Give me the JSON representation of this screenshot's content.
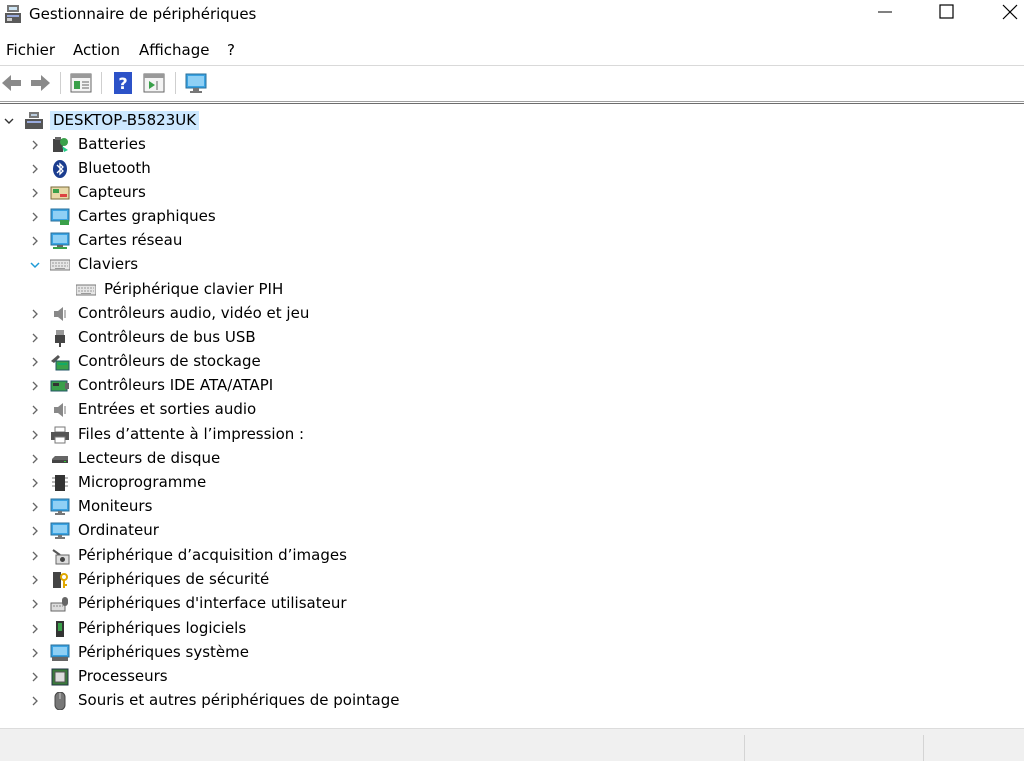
{
  "window": {
    "title": "Gestionnaire de périphériques",
    "minimize_glyph": "—",
    "maximize_glyph": "☐",
    "close_glyph": "✕"
  },
  "menu": {
    "items": [
      "Fichier",
      "Action",
      "Affichage",
      "?"
    ]
  },
  "toolbar": {
    "buttons": [
      "back-arrow-icon",
      "forward-arrow-icon",
      "properties-icon",
      "help-icon",
      "action-pane-icon",
      "monitor-scan-icon"
    ]
  },
  "tree": {
    "root": "DESKTOP-B5823UK",
    "categories": [
      {
        "label": "Batteries",
        "icon": "battery-icon",
        "expanded": false
      },
      {
        "label": "Bluetooth",
        "icon": "bluetooth-icon",
        "expanded": false
      },
      {
        "label": "Capteurs",
        "icon": "sensor-icon",
        "expanded": false
      },
      {
        "label": "Cartes graphiques",
        "icon": "display-adapter-icon",
        "expanded": false
      },
      {
        "label": "Cartes réseau",
        "icon": "network-adapter-icon",
        "expanded": false
      },
      {
        "label": "Claviers",
        "icon": "keyboard-icon",
        "expanded": true,
        "children": [
          "Périphérique clavier PIH"
        ]
      },
      {
        "label": "Contrôleurs audio, vidéo et jeu",
        "icon": "speaker-icon",
        "expanded": false
      },
      {
        "label": "Contrôleurs de bus USB",
        "icon": "usb-icon",
        "expanded": false
      },
      {
        "label": "Contrôleurs de stockage",
        "icon": "storage-controller-icon",
        "expanded": false
      },
      {
        "label": "Contrôleurs IDE ATA/ATAPI",
        "icon": "ide-controller-icon",
        "expanded": false
      },
      {
        "label": "Entrées et sorties audio",
        "icon": "speaker-icon",
        "expanded": false
      },
      {
        "label": "Files d’attente à l’impression :",
        "icon": "printer-icon",
        "expanded": false
      },
      {
        "label": "Lecteurs de disque",
        "icon": "disk-drive-icon",
        "expanded": false
      },
      {
        "label": "Microprogramme",
        "icon": "firmware-chip-icon",
        "expanded": false
      },
      {
        "label": "Moniteurs",
        "icon": "monitor-icon",
        "expanded": false
      },
      {
        "label": "Ordinateur",
        "icon": "computer-icon",
        "expanded": false
      },
      {
        "label": "Périphérique d’acquisition d’images",
        "icon": "camera-icon",
        "expanded": false
      },
      {
        "label": "Périphériques de sécurité",
        "icon": "security-key-icon",
        "expanded": false
      },
      {
        "label": "Périphériques d'interface utilisateur",
        "icon": "hid-icon",
        "expanded": false
      },
      {
        "label": "Périphériques logiciels",
        "icon": "software-device-icon",
        "expanded": false
      },
      {
        "label": "Périphériques système",
        "icon": "system-device-icon",
        "expanded": false
      },
      {
        "label": "Processeurs",
        "icon": "processor-icon",
        "expanded": false
      },
      {
        "label": "Souris et autres périphériques de pointage",
        "icon": "mouse-icon",
        "expanded": false
      }
    ]
  },
  "colors": {
    "selection": "#cce8ff",
    "expanded_chevron": "#1e9bd7",
    "collapsed_chevron": "#555555",
    "statusbar": "#f0f0f0"
  }
}
